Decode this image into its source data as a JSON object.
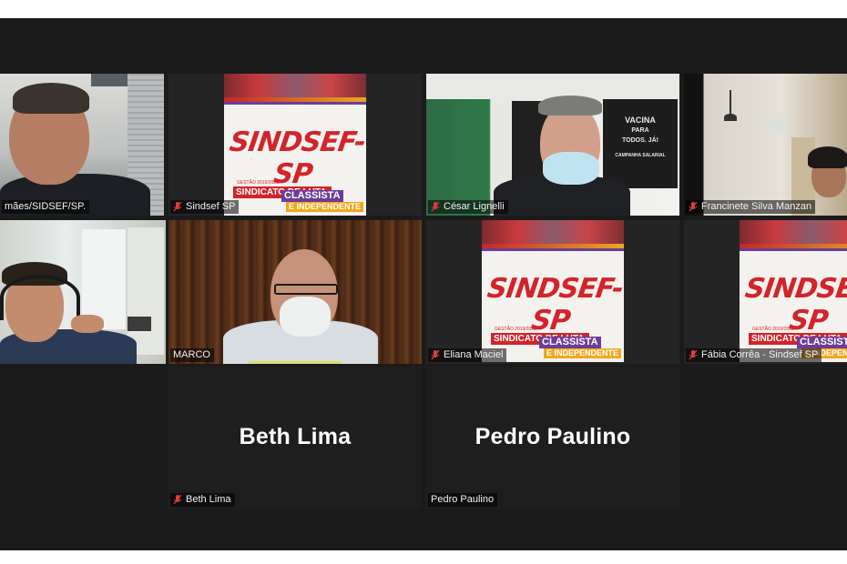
{
  "accent_color": "#d8e06a",
  "mic_icon": "mic-off-icon",
  "poster": {
    "title": "SINDSEF-SP",
    "small_text": "GESTÃO 2019/2022",
    "badge1": "SINDICATO DE LUTA,",
    "badge2": "CLASSISTA",
    "badge3": "E INDEPENDENTE"
  },
  "room_sign": {
    "line1": "VACINA",
    "line2": "PARA",
    "line3": "TODOS. JÁ!",
    "line4": "CAMPANHA SALARIAL"
  },
  "participants": [
    {
      "name": "mães/SIDSEF/SP.",
      "muted": false
    },
    {
      "name": "Sindsef SP",
      "muted": true
    },
    {
      "name": "César Lignelli",
      "muted": true
    },
    {
      "name": "Francinete Silva Manzan",
      "muted": true
    },
    {
      "name": "",
      "muted": false,
      "speaking": true
    },
    {
      "name": "MARCO",
      "muted": false
    },
    {
      "name": "Eliana Maciel",
      "muted": true
    },
    {
      "name": "Fábia Corrêa - Sindsef SP",
      "muted": true
    },
    {
      "name": "Beth Lima",
      "muted": true,
      "display_name": "Beth Lima"
    },
    {
      "name": "Pedro Paulino",
      "muted": false,
      "display_name": "Pedro Paulino"
    }
  ]
}
